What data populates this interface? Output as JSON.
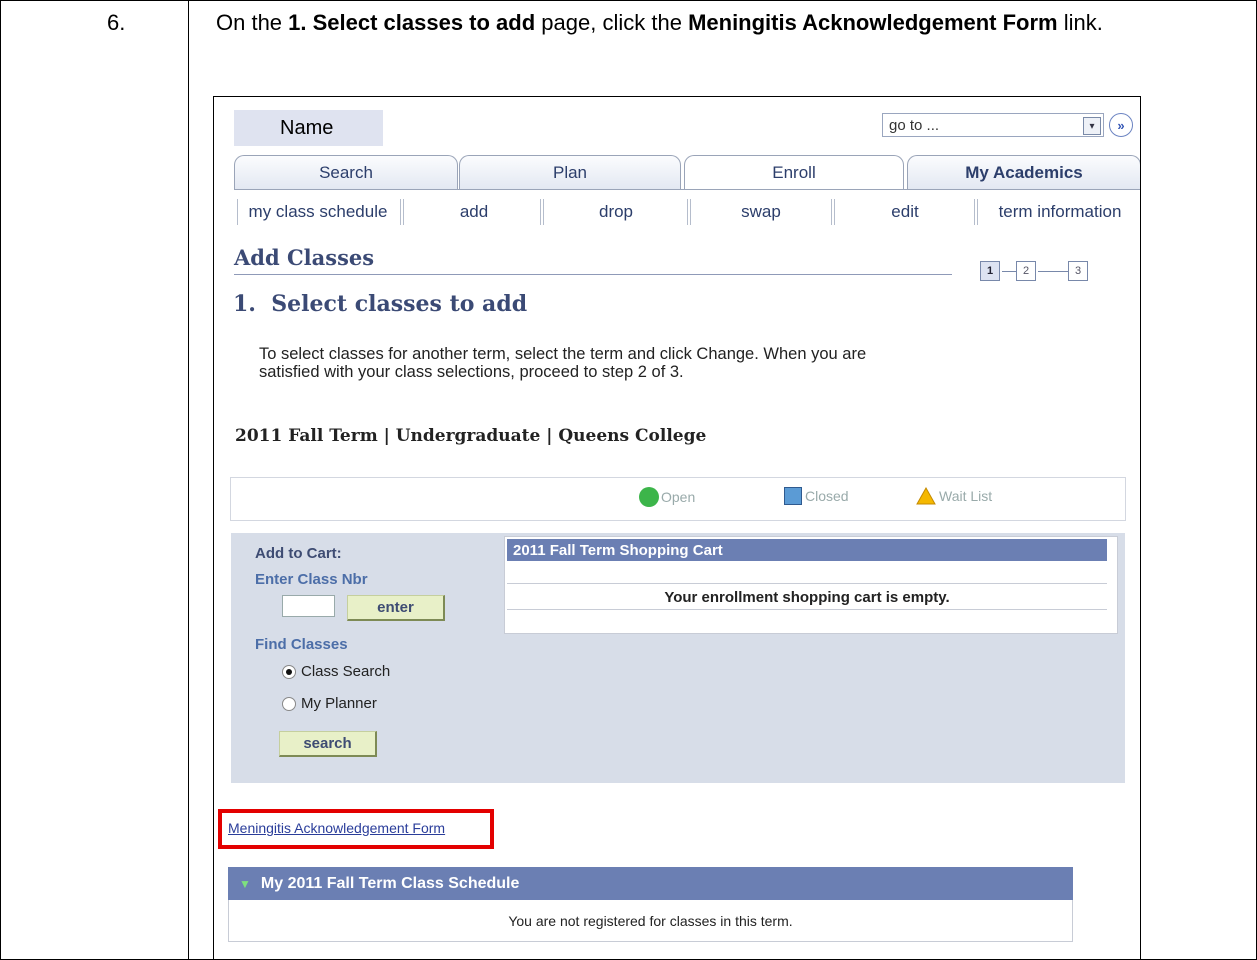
{
  "step": {
    "number": "6.",
    "text_parts": [
      "On the ",
      "1.  Select classes to add",
      " page, click the ",
      "Meningitis Acknowledgement Form",
      " link."
    ]
  },
  "header": {
    "name_label": "Name",
    "goto_value": "go to ...",
    "go_button": "»"
  },
  "tabs": [
    "Search",
    "Plan",
    "Enroll",
    "My Academics"
  ],
  "active_tab": "Enroll",
  "subnav": [
    "my class schedule",
    "add",
    "drop",
    "swap",
    "edit",
    "term information"
  ],
  "page": {
    "title": "Add Classes",
    "steps": [
      "1",
      "2",
      "3"
    ],
    "current_step": "1",
    "subtitle": "1.  Select classes to add",
    "instructions_line1": "To select classes for another term, select the term and click Change.  When you are",
    "instructions_line2": "satisfied with your class selections, proceed to step 2 of 3.",
    "term_line": "2011 Fall Term | Undergraduate | Queens College"
  },
  "legend": {
    "open": "Open",
    "closed": "Closed",
    "wait_list": "Wait List",
    "colors": {
      "open": "#3cb54a",
      "closed": "#5b9bd5",
      "wait_list": "#f5b800"
    }
  },
  "add_panel": {
    "add_to_cart": "Add to Cart:",
    "enter_class_nbr": "Enter Class Nbr",
    "class_nbr_value": "",
    "enter_button": "enter",
    "find_classes": "Find Classes",
    "radio_options": [
      "Class Search",
      "My Planner"
    ],
    "selected_option": "Class Search",
    "search_button": "search"
  },
  "cart": {
    "title": "2011 Fall Term Shopping Cart",
    "empty_message": "Your enrollment shopping cart is empty."
  },
  "meningitis_link": "Meningitis Acknowledgement Form",
  "schedule": {
    "title": "My 2011 Fall Term Class Schedule",
    "message": "You are not registered for classes in this term."
  },
  "colors": {
    "highlight": "#e30000",
    "header_bar": "#6b7fb3",
    "panel": "#d7dde8"
  }
}
